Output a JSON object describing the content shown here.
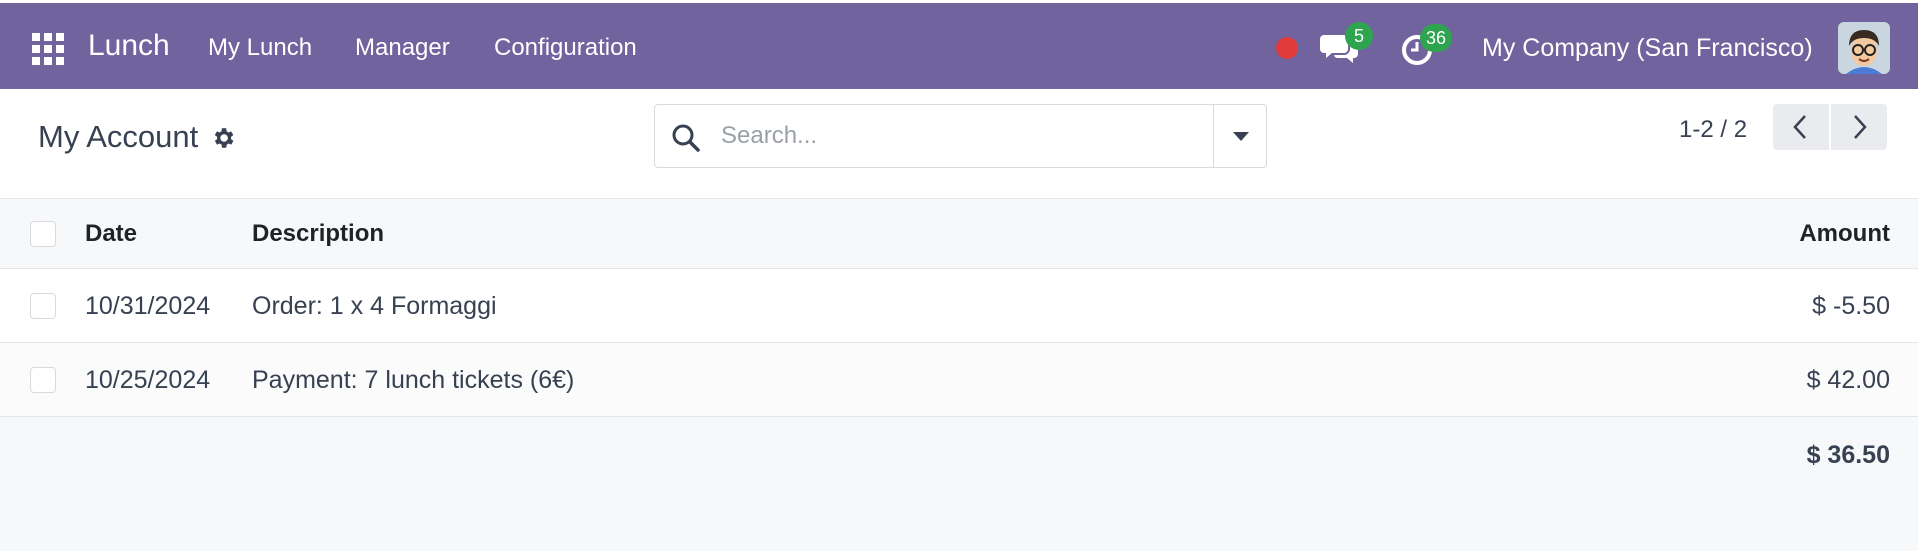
{
  "app": {
    "name": "Lunch",
    "menu": [
      "My Lunch",
      "Manager",
      "Configuration"
    ],
    "messages_count": "5",
    "activities_count": "36",
    "company": "My Company (San Francisco)"
  },
  "control": {
    "title": "My Account",
    "search_placeholder": "Search...",
    "pager": "1-2 / 2"
  },
  "table": {
    "headers": {
      "date": "Date",
      "description": "Description",
      "amount": "Amount"
    },
    "rows": [
      {
        "date": "10/31/2024",
        "description": "Order: 1 x 4 Formaggi",
        "amount": "$ -5.50"
      },
      {
        "date": "10/25/2024",
        "description": "Payment: 7 lunch tickets (6€)",
        "amount": "$ 42.00"
      }
    ],
    "total": "$ 36.50"
  },
  "colors": {
    "nav_bg": "#71639e",
    "badge": "#2ea44f",
    "record_dot": "#e03a3a"
  },
  "icons": [
    "apps-grid-icon",
    "record-dot-icon",
    "chat-icon",
    "activity-clock-icon",
    "avatar",
    "gear-icon",
    "search-icon",
    "caret-down-icon",
    "chevron-left-icon",
    "chevron-right-icon"
  ]
}
